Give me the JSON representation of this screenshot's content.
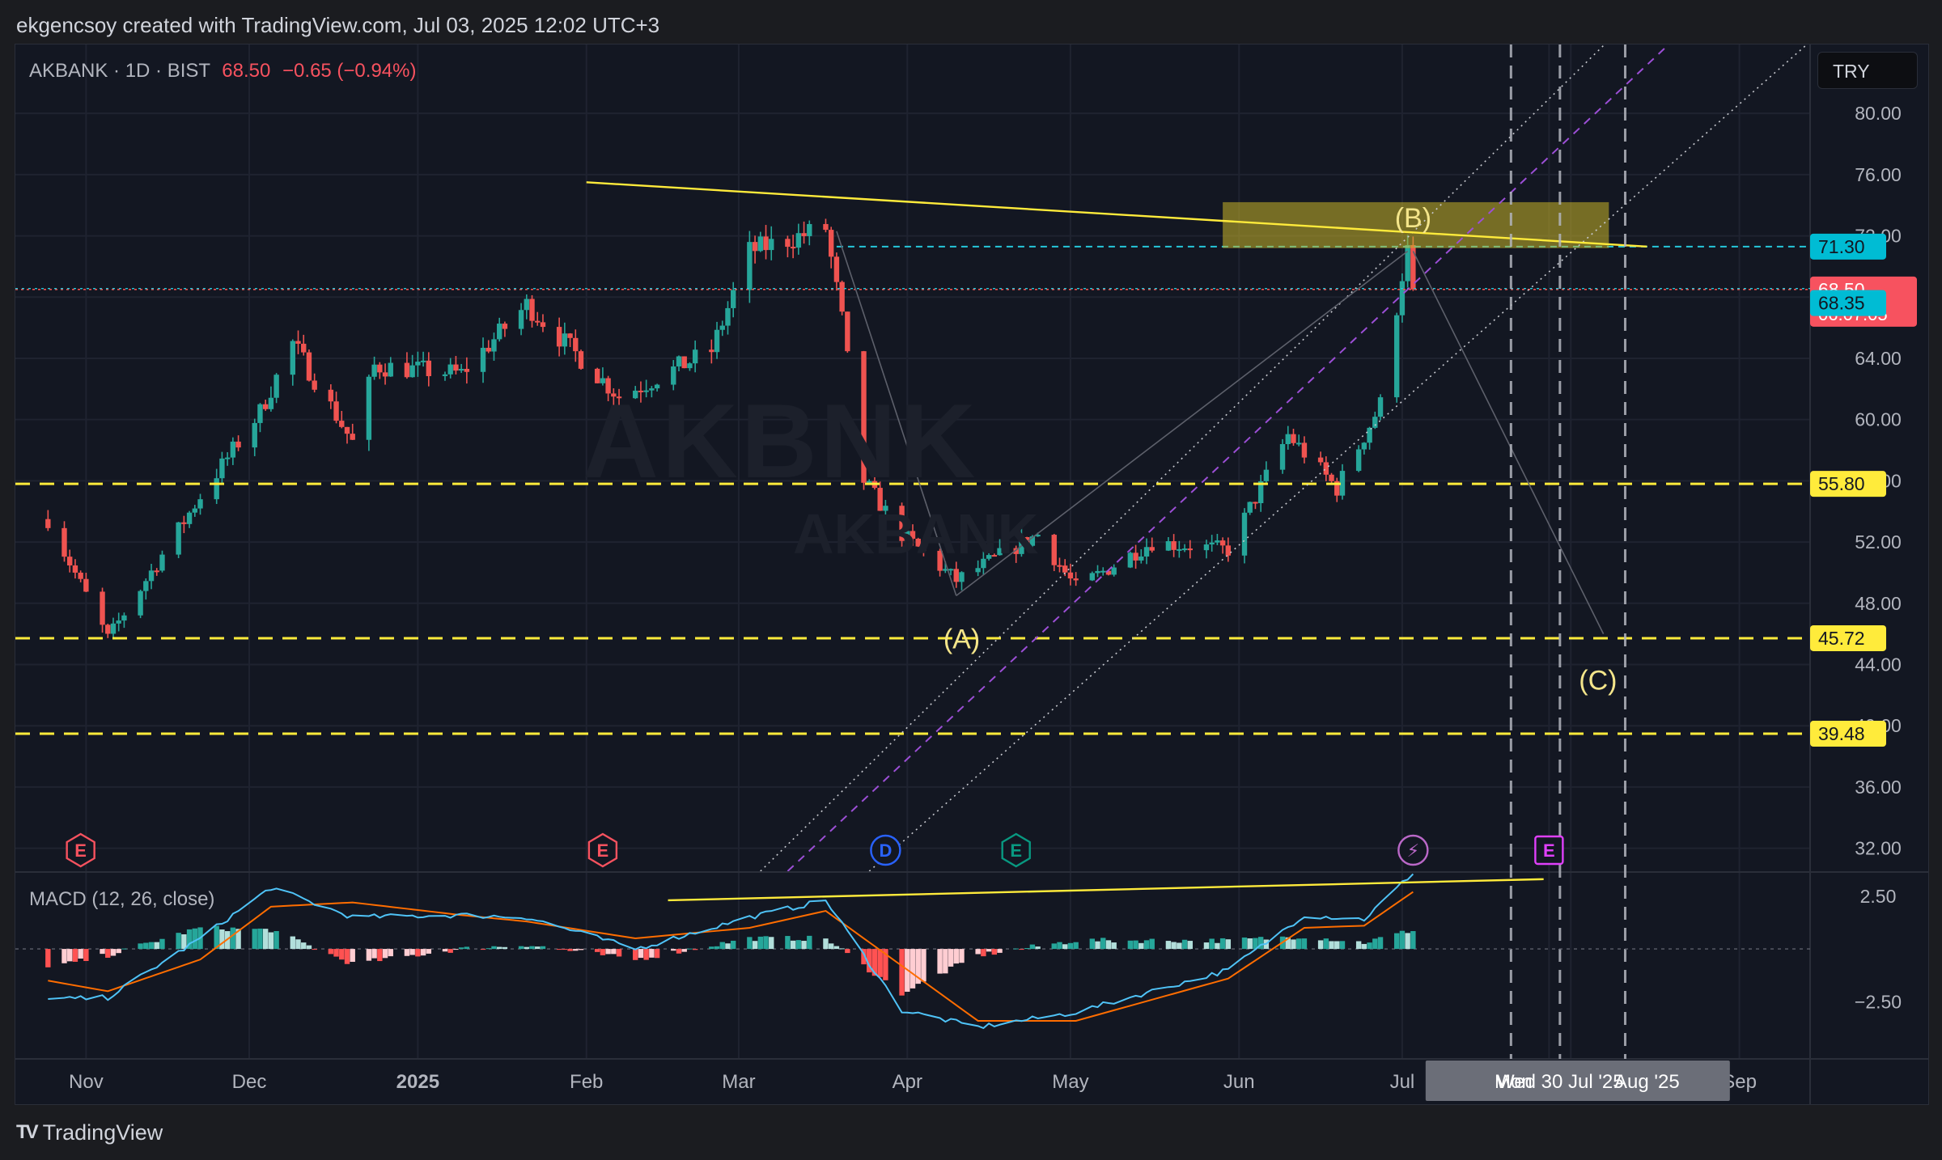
{
  "topbar": {
    "text": "ekgencsoy created with TradingView.com, Jul 03, 2025 12:02 UTC+3"
  },
  "header": {
    "symbol": "AKBANK · 1D · BIST",
    "price": "68.50",
    "change": "−0.65 (−0.94%)"
  },
  "currency": "TRY",
  "watermark": {
    "line1": "AKBNK",
    "line2": "AKBANK"
  },
  "macd_label": "MACD (12, 26, close)",
  "footer": {
    "logo": "TV",
    "brand": "TradingView"
  },
  "colors": {
    "up": "#26a69a",
    "down": "#ef5350",
    "yellow": "#ffeb3b",
    "teal_label": "#00bcd4",
    "red_label": "#f7525f",
    "bg": "#131722"
  },
  "chart_data": {
    "type": "candlestick",
    "symbol": "AKBANK",
    "interval": "1D",
    "exchange": "BIST",
    "y_ticks": [
      "32.00",
      "36.00",
      "40.00",
      "44.00",
      "48.00",
      "52.00",
      "56.00",
      "60.00",
      "64.00",
      "68.00",
      "72.00",
      "76.00",
      "80.00"
    ],
    "ylim": [
      30.5,
      84.5
    ],
    "x_ticks": [
      {
        "label": "Nov",
        "date": "2024-11-01"
      },
      {
        "label": "Dec",
        "date": "2024-12-01"
      },
      {
        "label": "2025",
        "date": "2025-01-01",
        "bold": true
      },
      {
        "label": "Feb",
        "date": "2025-02-01"
      },
      {
        "label": "Mar",
        "date": "2025-03-01"
      },
      {
        "label": "Apr",
        "date": "2025-04-01"
      },
      {
        "label": "May",
        "date": "2025-05-01"
      },
      {
        "label": "Jun",
        "date": "2025-06-01"
      },
      {
        "label": "Jul",
        "date": "2025-07-01"
      },
      {
        "label": "Mon",
        "date": "2025-07-28"
      },
      {
        "label": "Aug '25",
        "date": "2025-08-01"
      },
      {
        "label": "Sep",
        "date": "2025-09-01"
      }
    ],
    "crosshair_x_label": "Wed 30 Jul '25",
    "price_labels": [
      {
        "value": 71.3,
        "text": "71.30",
        "style": "teal"
      },
      {
        "value": 68.5,
        "text": "68.50",
        "sub": "06:07:05",
        "style": "red"
      },
      {
        "value": 68.35,
        "text": "68.35",
        "style": "teal"
      },
      {
        "value": 55.8,
        "text": "55.80",
        "style": "yellow"
      },
      {
        "value": 45.72,
        "text": "45.72",
        "style": "yellow"
      },
      {
        "value": 39.48,
        "text": "39.48",
        "style": "yellow"
      }
    ],
    "key_points": [
      {
        "date": "2024-10-25",
        "price": 53.5
      },
      {
        "date": "2024-11-05",
        "price": 45.7
      },
      {
        "date": "2024-11-22",
        "price": 55.0
      },
      {
        "date": "2024-12-03",
        "price": 60.5
      },
      {
        "date": "2024-12-09",
        "price": 65.0
      },
      {
        "date": "2024-12-20",
        "price": 58.5
      },
      {
        "date": "2024-12-24",
        "price": 63.5
      },
      {
        "date": "2025-01-09",
        "price": 63.0
      },
      {
        "date": "2025-01-21",
        "price": 67.5
      },
      {
        "date": "2025-02-07",
        "price": 61.5
      },
      {
        "date": "2025-02-24",
        "price": 64.5
      },
      {
        "date": "2025-03-03",
        "price": 71.0
      },
      {
        "date": "2025-03-17",
        "price": 72.5
      },
      {
        "date": "2025-03-20",
        "price": 66.5
      },
      {
        "date": "2025-03-24",
        "price": 56.0
      },
      {
        "date": "2025-03-31",
        "price": 52.5
      },
      {
        "date": "2025-04-10",
        "price": 49.5
      },
      {
        "date": "2025-04-25",
        "price": 52.5
      },
      {
        "date": "2025-05-02",
        "price": 49.0
      },
      {
        "date": "2025-05-16",
        "price": 52.0
      },
      {
        "date": "2025-05-30",
        "price": 51.5
      },
      {
        "date": "2025-06-10",
        "price": 59.0
      },
      {
        "date": "2025-06-19",
        "price": 55.5
      },
      {
        "date": "2025-06-27",
        "price": 61.0
      },
      {
        "date": "2025-07-01",
        "price": 69.5
      },
      {
        "date": "2025-07-02",
        "price": 71.0
      },
      {
        "date": "2025-07-03",
        "price": 68.5
      }
    ],
    "annotations": [
      {
        "text": "(A)",
        "date": "2025-04-11",
        "price": 45.7
      },
      {
        "text": "(B)",
        "date": "2025-07-03",
        "price": 73.2
      },
      {
        "text": "(C)",
        "date": "2025-08-06",
        "price": 43.0
      }
    ],
    "trendline": {
      "from": {
        "date": "2025-02-01",
        "price": 75.5
      },
      "to": {
        "date": "2025-08-15",
        "price": 71.3
      }
    },
    "zone": {
      "from_date": "2025-05-29",
      "to_date": "2025-08-08",
      "top": 74.2,
      "bottom": 71.2
    },
    "channel": [
      {
        "from": {
          "date": "2025-03-05",
          "price": 30.5
        },
        "to": {
          "date": "2025-09-15",
          "price": 98.0
        },
        "style": "dotted"
      },
      {
        "from": {
          "date": "2025-03-10",
          "price": 30.5
        },
        "to": {
          "date": "2025-09-15",
          "price": 93.5
        },
        "style": "dashed-purple"
      },
      {
        "from": {
          "date": "2025-03-25",
          "price": 30.5
        },
        "to": {
          "date": "2025-09-15",
          "price": 85.0
        },
        "style": "dotted"
      }
    ],
    "horizontal_levels": [
      55.8,
      45.72,
      39.48
    ],
    "dashed_level": 71.3,
    "event_markers": [
      {
        "text": "E",
        "date": "2024-10-31",
        "color": "#f7525f"
      },
      {
        "text": "E",
        "date": "2025-02-04",
        "color": "#f7525f"
      },
      {
        "text": "D",
        "date": "2025-03-28",
        "color": "#2962ff"
      },
      {
        "text": "E",
        "date": "2025-04-21",
        "color": "#089981"
      },
      {
        "text": "⚡",
        "date": "2025-07-03",
        "color": "#ba68c8"
      },
      {
        "text": "E",
        "date": "2025-07-28",
        "color": "#e040fb"
      }
    ],
    "vertical_lines": [
      "2025-07-21",
      "2025-07-30",
      "2025-08-11"
    ],
    "macd": {
      "y_ticks": [
        "2.50",
        "−2.50"
      ],
      "ylim": [
        -5.2,
        3.6
      ],
      "key_points": [
        {
          "date": "2024-10-25",
          "macd": -2.4,
          "signal": -1.5,
          "hist": -0.9
        },
        {
          "date": "2024-11-05",
          "macd": -2.3,
          "signal": -2.0,
          "hist": -0.3
        },
        {
          "date": "2024-11-22",
          "macd": 0.5,
          "signal": -0.5,
          "hist": 1.0
        },
        {
          "date": "2024-12-05",
          "macd": 2.9,
          "signal": 2.0,
          "hist": 0.9
        },
        {
          "date": "2024-12-20",
          "macd": 1.5,
          "signal": 2.2,
          "hist": -0.7
        },
        {
          "date": "2025-01-09",
          "macd": 1.6,
          "signal": 1.6,
          "hist": 0.0
        },
        {
          "date": "2025-01-21",
          "macd": 1.5,
          "signal": 1.3,
          "hist": 0.2
        },
        {
          "date": "2025-02-10",
          "macd": 0.0,
          "signal": 0.5,
          "hist": -0.5
        },
        {
          "date": "2025-03-03",
          "macd": 1.5,
          "signal": 1.0,
          "hist": 0.5
        },
        {
          "date": "2025-03-17",
          "macd": 2.3,
          "signal": 1.8,
          "hist": 0.5
        },
        {
          "date": "2025-03-31",
          "macd": -2.9,
          "signal": -0.8,
          "hist": -2.1
        },
        {
          "date": "2025-04-14",
          "macd": -3.7,
          "signal": -3.4,
          "hist": -0.3
        },
        {
          "date": "2025-05-02",
          "macd": -3.0,
          "signal": -3.4,
          "hist": 0.4
        },
        {
          "date": "2025-05-30",
          "macd": -1.0,
          "signal": -1.4,
          "hist": 0.4
        },
        {
          "date": "2025-06-13",
          "macd": 1.6,
          "signal": 1.0,
          "hist": 0.6
        },
        {
          "date": "2025-06-24",
          "macd": 1.4,
          "signal": 1.1,
          "hist": 0.3
        },
        {
          "date": "2025-07-03",
          "macd": 3.6,
          "signal": 2.7,
          "hist": 0.9
        }
      ],
      "trendline": {
        "from": {
          "date": "2025-02-16",
          "macd": 2.3
        },
        "to": {
          "date": "2025-07-27",
          "macd": 3.3
        }
      }
    }
  }
}
